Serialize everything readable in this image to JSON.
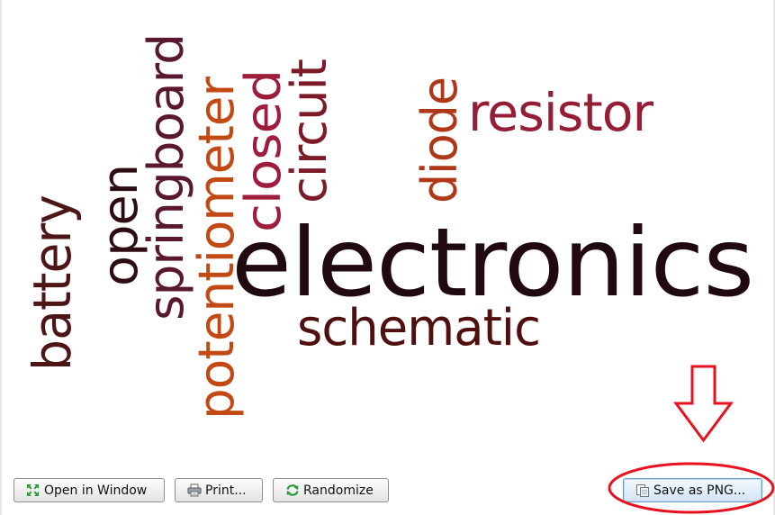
{
  "word_cloud": {
    "words": [
      {
        "text": "electronics",
        "color": "#200a10"
      },
      {
        "text": "schematic",
        "color": "#501010"
      },
      {
        "text": "resistor",
        "color": "#951e35"
      },
      {
        "text": "diode",
        "color": "#ae3818"
      },
      {
        "text": "circuit",
        "color": "#7d1c28"
      },
      {
        "text": "closed",
        "color": "#9f1d3c"
      },
      {
        "text": "potentiometer",
        "color": "#c24913"
      },
      {
        "text": "springboard",
        "color": "#5a1830"
      },
      {
        "text": "open",
        "color": "#2e0d12"
      },
      {
        "text": "battery",
        "color": "#4c1616"
      }
    ]
  },
  "toolbar": {
    "open_window_label": "Open in Window",
    "print_label": "Print...",
    "randomize_label": "Randomize",
    "save_png_label": "Save as PNG..."
  },
  "icons": {
    "open_window": "expand-arrows-icon",
    "print": "printer-icon",
    "randomize": "refresh-icon",
    "save_png": "save-document-icon"
  },
  "annotation": {
    "color": "#e8111f"
  }
}
